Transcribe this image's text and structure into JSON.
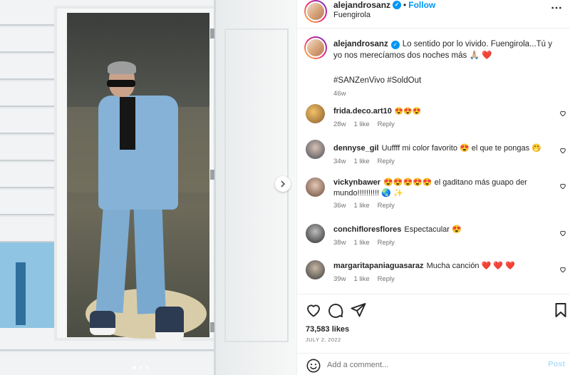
{
  "post": {
    "username": "alejandrosanz",
    "separator": "•",
    "follow_label": "Follow",
    "location": "Fuengirola",
    "more_label": "⋯"
  },
  "caption": {
    "username": "alejandrosanz",
    "text": "Lo sentido por lo vivido. Fuengirola...Tú y yo nos merecíamos dos noches más 🙏🏼 ❤️",
    "hashtags": "#SANZenVivo #SoldOut",
    "time": "46w"
  },
  "comments": [
    {
      "username": "frida.deco.art10",
      "text": "😍😍😍",
      "time": "28w",
      "likes": "1 like",
      "reply": "Reply"
    },
    {
      "username": "dennyse_gil",
      "text": "Uuffff mi color favorito 😍 el que te pongas 🤭",
      "time": "34w",
      "likes": "1 like",
      "reply": "Reply"
    },
    {
      "username": "vickynbawer",
      "text": "😍😍😍😍😍 el gaditano más guapo der mundo!!!!!!!!!! 🌏 ✨",
      "time": "36w",
      "likes": "1 like",
      "reply": "Reply"
    },
    {
      "username": "conchifloresflores",
      "text": "Espectacular 😍",
      "time": "38w",
      "likes": "1 like",
      "reply": "Reply"
    },
    {
      "username": "margaritapaniaguasaraz",
      "text": "Mucha canción ❤️ ❤️ ❤️",
      "time": "39w",
      "likes": "1 like",
      "reply": "Reply"
    }
  ],
  "actions": {
    "likes": "73,583 likes",
    "date": "JULY 2, 2022",
    "comment_placeholder": "Add a comment...",
    "post_label": "Post"
  },
  "icons": {
    "like": "heart-icon",
    "comment": "comment-bubble-icon",
    "share": "paper-plane-icon",
    "save": "bookmark-icon",
    "emoji": "smiley-icon",
    "next": "chevron-right-icon"
  },
  "colors": {
    "accent": "#0095f6",
    "text": "#262626",
    "secondary": "#737373",
    "hashtag": "#00376b",
    "post_disabled": "#b2dffc"
  },
  "carousel": {
    "slides": 3,
    "current": 1
  }
}
